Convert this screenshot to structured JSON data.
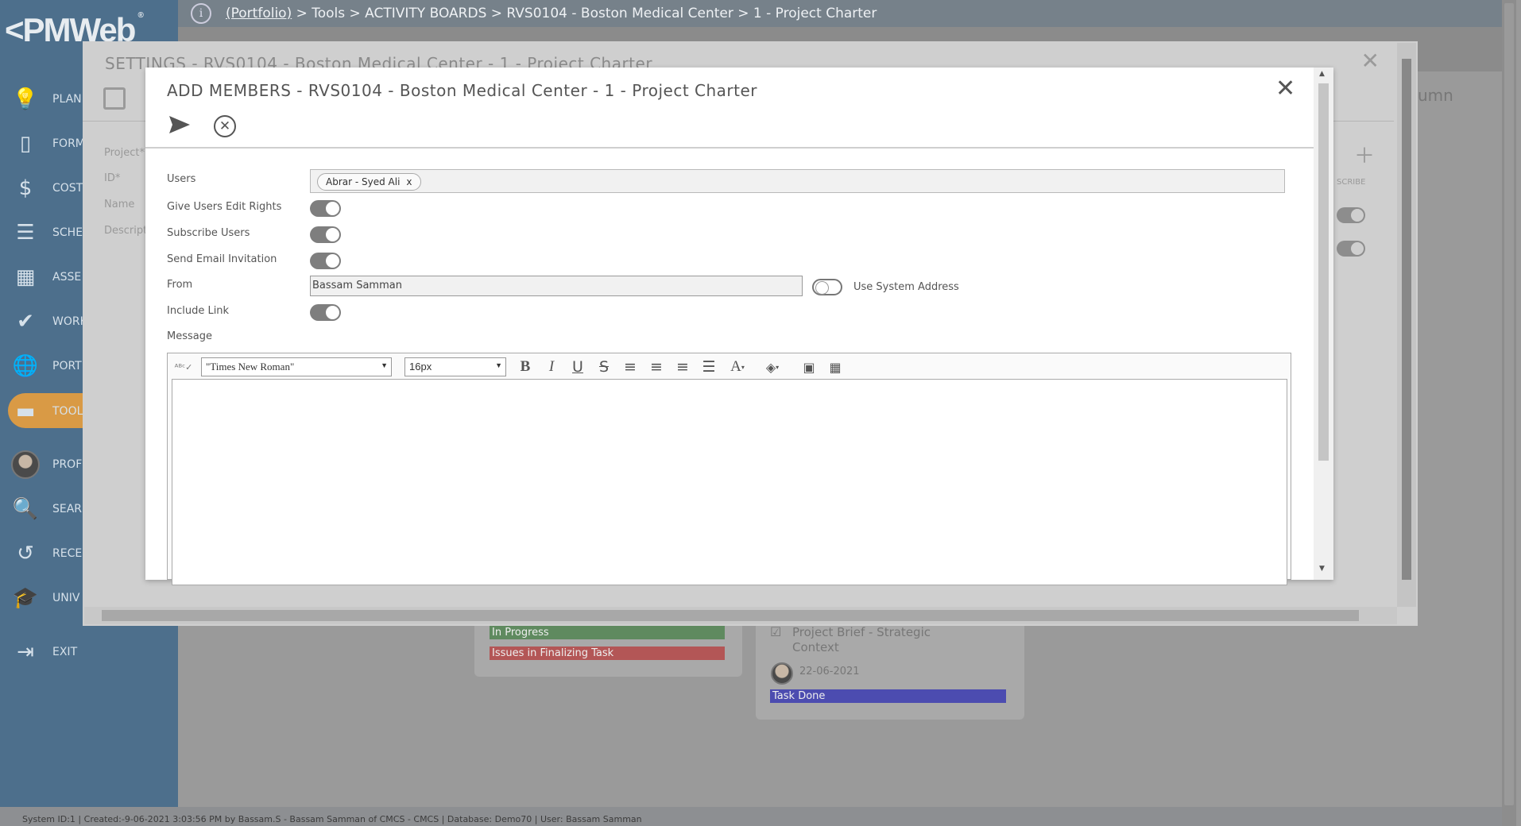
{
  "app": {
    "logo": "PMWeb",
    "logo_reg": "®"
  },
  "breadcrumb": {
    "portfolio": "(Portfolio)",
    "rest": " > Tools > ACTIVITY BOARDS > RVS0104 - Boston Medical Center > 1 - Project Charter"
  },
  "sidebar": {
    "items": [
      {
        "label": "Plan",
        "icon": "lightbulb-icon",
        "glyph": "💡"
      },
      {
        "label": "Form",
        "icon": "document-icon",
        "glyph": "▯"
      },
      {
        "label": "Cost",
        "icon": "dollar-icon",
        "glyph": "$"
      },
      {
        "label": "Sche",
        "icon": "schedule-bars-icon",
        "glyph": "☰"
      },
      {
        "label": "Asse",
        "icon": "building-icon",
        "glyph": "▦"
      },
      {
        "label": "Work",
        "icon": "checkmark-icon",
        "glyph": "✔"
      },
      {
        "label": "Port",
        "icon": "globe-icon",
        "glyph": "🌐"
      },
      {
        "label": "Tool",
        "icon": "toolbox-icon",
        "glyph": "▬"
      },
      {
        "label": "Prof",
        "icon": "avatar-icon",
        "glyph": ""
      },
      {
        "label": "Sear",
        "icon": "search-icon",
        "glyph": "🔍"
      },
      {
        "label": "Rece",
        "icon": "history-icon",
        "glyph": "↺"
      },
      {
        "label": "Univ",
        "icon": "graduation-cap-icon",
        "glyph": "🎓"
      },
      {
        "label": "Exit",
        "icon": "exit-icon",
        "glyph": "⇥"
      }
    ]
  },
  "settings": {
    "title": "SETTINGS - RVS0104 - Boston Medical Center - 1 - Project Charter",
    "fields": [
      "Project*",
      "ID*",
      "Name",
      "Descript"
    ],
    "right_text": "umn",
    "right_header": "SCRIBE"
  },
  "dialog": {
    "title": "ADD MEMBERS - RVS0104 - Boston Medical Center - 1 - Project Charter",
    "labels": {
      "users": "Users",
      "edit_rights": "Give Users Edit Rights",
      "subscribe": "Subscribe Users",
      "email": "Send Email Invitation",
      "from": "From",
      "include_link": "Include Link",
      "message": "Message",
      "use_system": "Use System Address"
    },
    "users": [
      {
        "name": "Abrar - Syed Ali"
      }
    ],
    "from_value": "Bassam Samman",
    "toggles": {
      "edit_rights": true,
      "subscribe": true,
      "email": true,
      "include_link": true,
      "use_system": false
    },
    "editor": {
      "font": "\"Times New Roman\"",
      "size": "16px"
    }
  },
  "board": {
    "card1_tags": [
      {
        "label": "In Progress",
        "color": "#5a8a5a"
      },
      {
        "label": "Issues in Finalizing Task",
        "color": "#b45656"
      }
    ],
    "card2_title": "Project Brief - Strategic Context",
    "card2_date": "22-06-2021",
    "card2_tag": {
      "label": "Task Done",
      "color": "#4a4aa8"
    }
  },
  "status_bar": "System ID:1 | Created:-9-06-2021 3:03:56 PM by Bassam.S - Bassam Samman of CMCS - CMCS | Database: Demo70 | User: Bassam Samman"
}
